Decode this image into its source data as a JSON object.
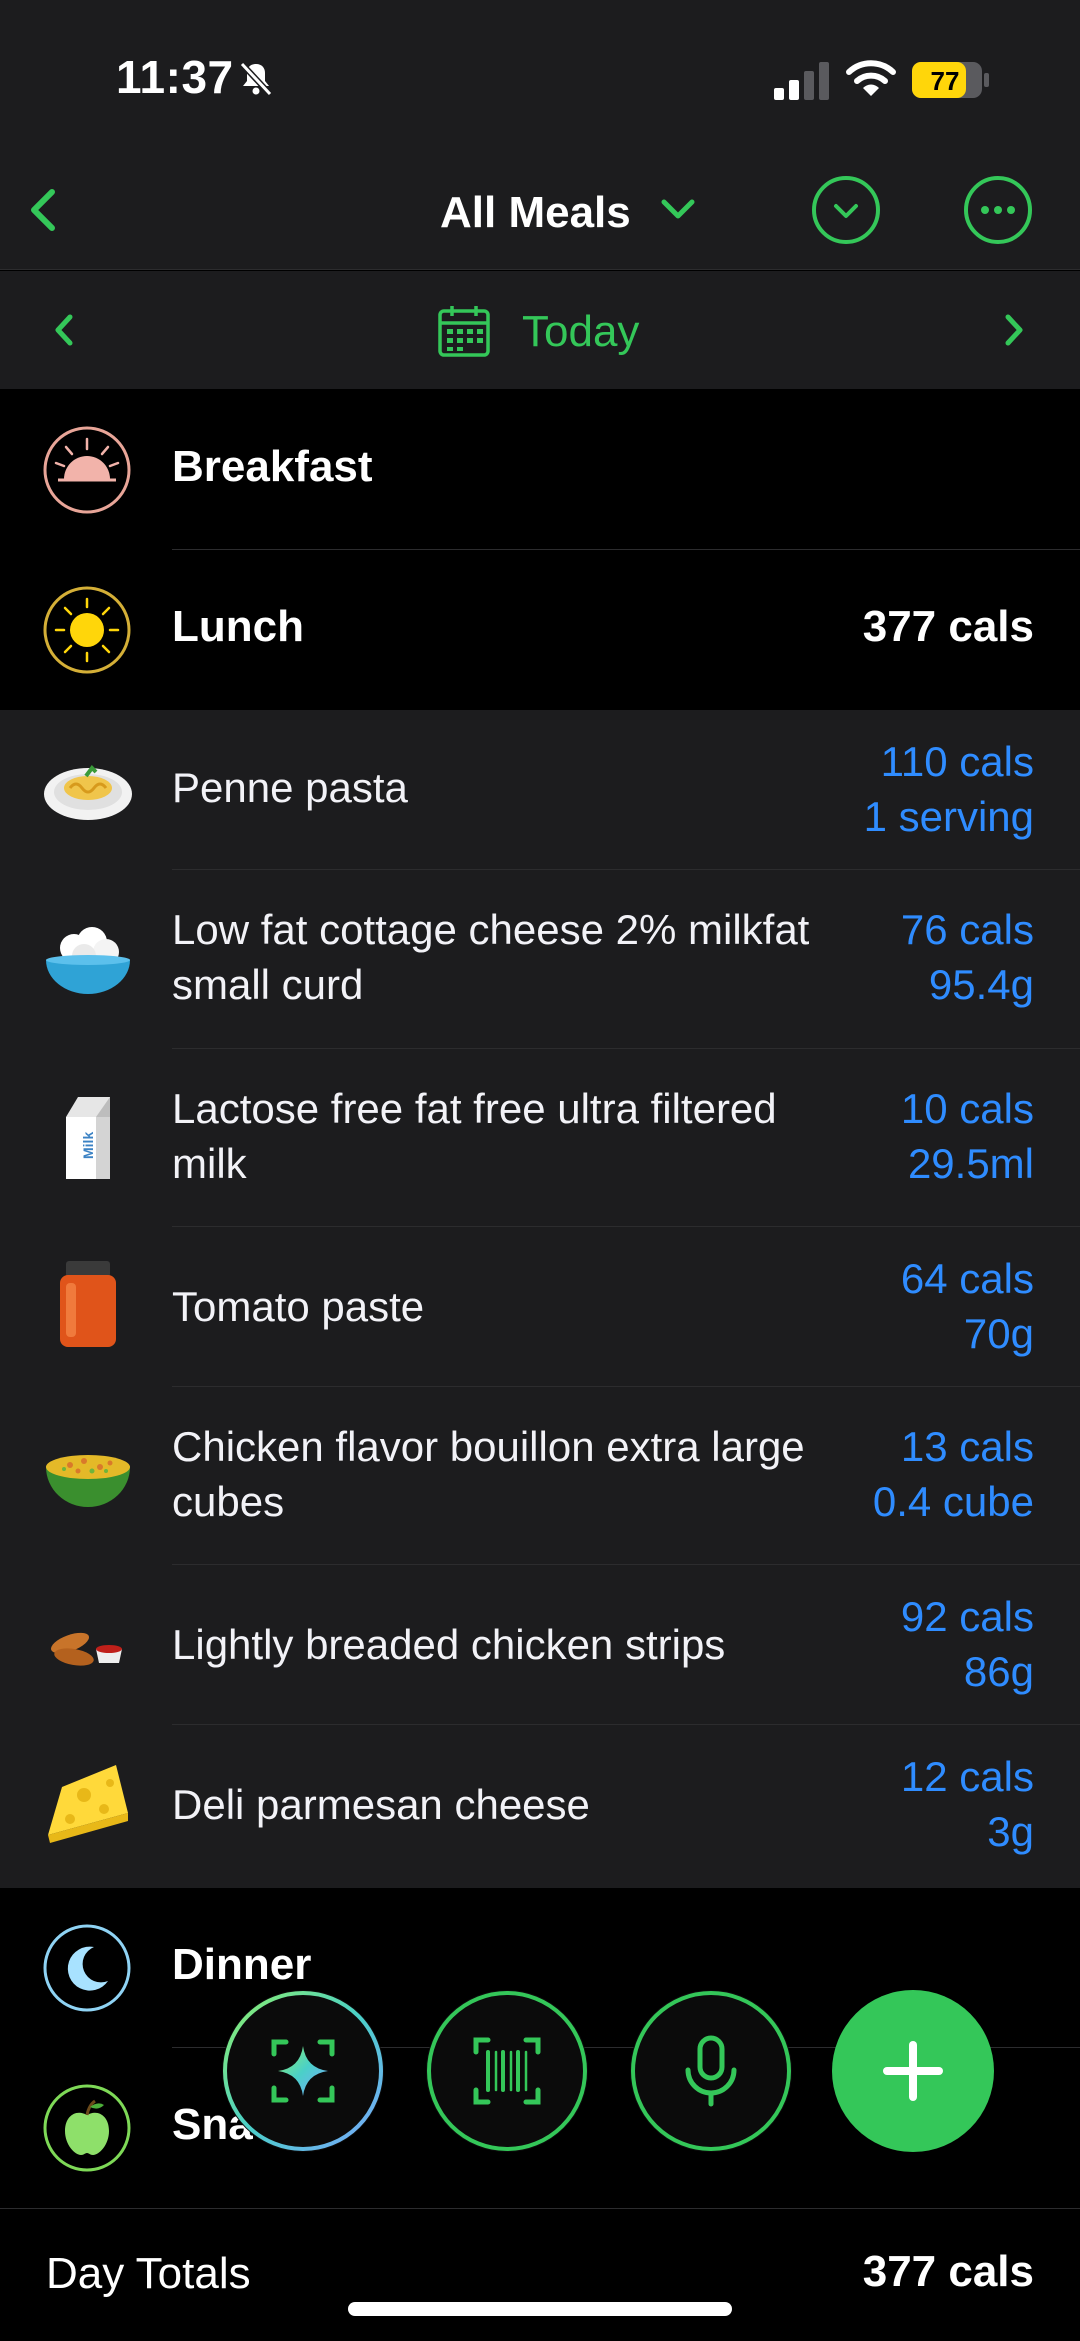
{
  "status": {
    "time": "11:37",
    "battery": "77"
  },
  "nav": {
    "title": "All Meals"
  },
  "date": {
    "label": "Today"
  },
  "meals": {
    "breakfast": {
      "name": "Breakfast",
      "cals": ""
    },
    "lunch": {
      "name": "Lunch",
      "cals": "377 cals"
    },
    "dinner": {
      "name": "Dinner"
    },
    "snacks": {
      "name": "Snacks"
    }
  },
  "foods": [
    {
      "name": "Penne pasta",
      "cals": "110 cals",
      "amount": "1 serving",
      "icon": "pasta-icon"
    },
    {
      "name": "Low fat cottage cheese 2% milkfat small curd",
      "cals": "76 cals",
      "amount": "95.4g",
      "icon": "cottage-cheese-icon"
    },
    {
      "name": "Lactose free fat free ultra filtered milk",
      "cals": "10 cals",
      "amount": "29.5ml",
      "icon": "milk-carton-icon"
    },
    {
      "name": "Tomato paste",
      "cals": "64 cals",
      "amount": "70g",
      "icon": "jar-icon"
    },
    {
      "name": "Chicken flavor bouillon extra large cubes",
      "cals": "13 cals",
      "amount": "0.4 cube",
      "icon": "soup-bowl-icon"
    },
    {
      "name": "Lightly breaded chicken strips",
      "cals": "92 cals",
      "amount": "86g",
      "icon": "chicken-strips-icon"
    },
    {
      "name": "Deli parmesan cheese",
      "cals": "12 cals",
      "amount": "3g",
      "icon": "cheese-icon"
    }
  ],
  "totals": {
    "label": "Day Totals",
    "cals": "377 cals"
  },
  "colors": {
    "accent": "#34c759",
    "link": "#2f8cff",
    "background": "#1c1c1e"
  }
}
